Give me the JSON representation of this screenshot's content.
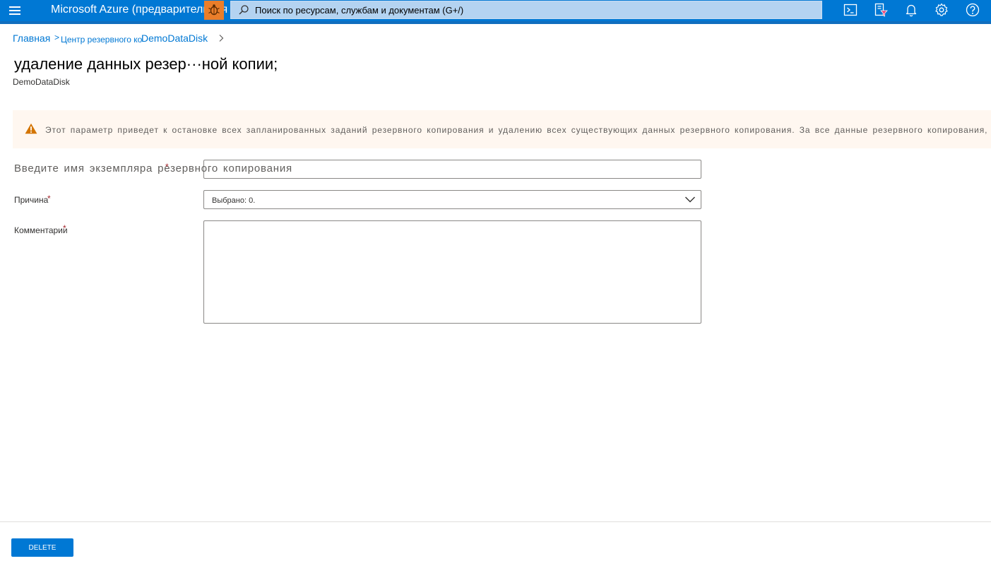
{
  "topbar": {
    "brand": "Microsoft Azure (предварительная версия)",
    "search_placeholder": "Поиск по ресурсам, службам и документам (G+/)",
    "icons": [
      "hamburger-icon",
      "preview-bug-icon",
      "search-icon",
      "cloud-shell-icon",
      "directory-filter-icon",
      "notifications-bell-icon",
      "gear-icon",
      "help-icon"
    ]
  },
  "breadcrumb": {
    "home": "Главная",
    "separator": ">",
    "center": "Центр резервного копирования",
    "disk": "DemoDataDisk"
  },
  "header": {
    "title": "удаление данных резер···ной копии;",
    "subtitle": "DemoDataDisk"
  },
  "warning": {
    "text": "Этот параметр приведет к остановке всех запланированных заданий резервного копирования и удалению всех существующих данных резервного копирования. За все данные резервного копирования, хранящиеся"
  },
  "form": {
    "instance_label": "Введите имя экземпляра резервного копирования",
    "instance_value": "",
    "reason_label": "Причина",
    "reason_selected": "Выбрано: 0.",
    "comments_label": "Комментарии",
    "comments_value": "",
    "required_mark": "*"
  },
  "footer": {
    "delete_label": "DELETE"
  },
  "colors": {
    "accent": "#0078d4",
    "warning_icon": "#d47500",
    "warning_bg": "#fff7f0",
    "required": "#a4262c"
  }
}
